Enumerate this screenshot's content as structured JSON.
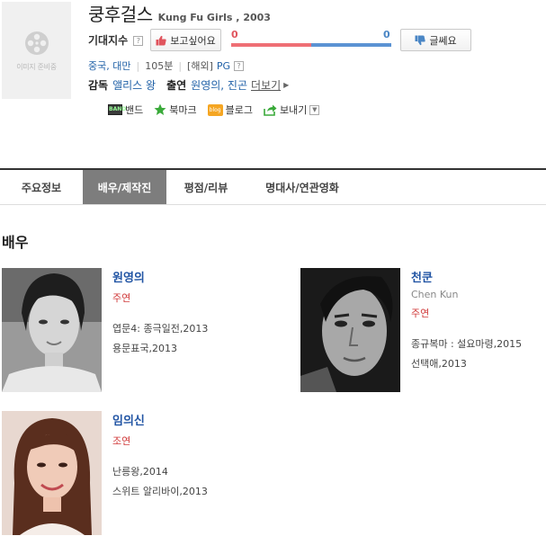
{
  "poster": {
    "placeholder": "이미지 준비중",
    "icon": "film-reel-icon"
  },
  "movie": {
    "title_ko": "쿵후걸스",
    "title_en": "Kung Fu Girls , 2003"
  },
  "expectation": {
    "label": "기대지수",
    "help": "?",
    "like_label": "보고싶어요",
    "dislike_label": "글쎄요",
    "like_score": "0",
    "dislike_score": "0",
    "like_ratio": 0.5,
    "colors": {
      "like": "#ef6f75",
      "dislike": "#5b93d3"
    }
  },
  "meta": {
    "country": "중국, 대만",
    "runtime": "105분",
    "release": "[해외]",
    "rating": "PG",
    "help": "?"
  },
  "credits": {
    "director_label": "감독",
    "director": "앨리스 왕",
    "cast_label": "출연",
    "cast": "원영의, 진곤",
    "more": "더보기"
  },
  "share": {
    "band": "밴드",
    "bookmark": "북마크",
    "blog": "블로그",
    "send": "보내기",
    "band_icon_text": "BAND",
    "blog_icon_text": "blog"
  },
  "tabs": [
    {
      "label": "주요정보"
    },
    {
      "label": "배우/제작진"
    },
    {
      "label": "평점/리뷰"
    },
    {
      "label": "명대사/연관영화"
    }
  ],
  "section_title": "배우",
  "actors": [
    {
      "name": "원영의",
      "english": "",
      "role": "주연",
      "works": [
        "엽문4: 종극일전,2013",
        "용문표국,2013"
      ]
    },
    {
      "name": "천쿤",
      "english": "Chen Kun",
      "role": "주연",
      "works": [
        "종규복마 : 설요마령,2015",
        "선택애,2013"
      ]
    },
    {
      "name": "임의신",
      "english": "",
      "role": "조연",
      "works": [
        "난릉왕,2014",
        "스위트 알리바이,2013"
      ]
    }
  ]
}
